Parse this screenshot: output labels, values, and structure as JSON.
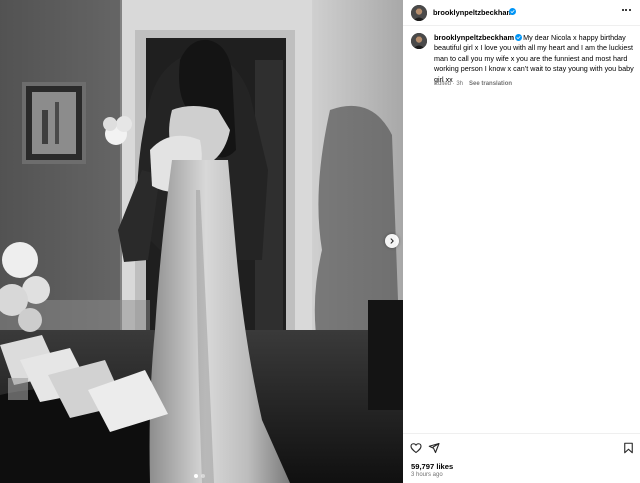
{
  "post": {
    "username": "brooklynpeltzbeckham",
    "caption": "My dear Nicola x happy birthday beautiful girl x I love you with all my heart and I am the luckiest man to call you my wife x you are the funniest and most hard working person I know x can’t wait to stay young with you baby girl xx",
    "edited_label": "Edited · 3h",
    "see_translation": "See translation",
    "likes": "59,797 likes",
    "time_ago": "3 hours ago"
  },
  "carousel": {
    "count": 2,
    "active": 1
  },
  "icons": {
    "verified": "verified-badge-icon",
    "more": "more-options-icon",
    "like": "heart-icon",
    "share": "paper-plane-icon",
    "save": "bookmark-icon",
    "next": "chevron-right-icon"
  },
  "colors": {
    "verified": "#0095f6",
    "muted": "#737373",
    "divider": "#efefef"
  }
}
